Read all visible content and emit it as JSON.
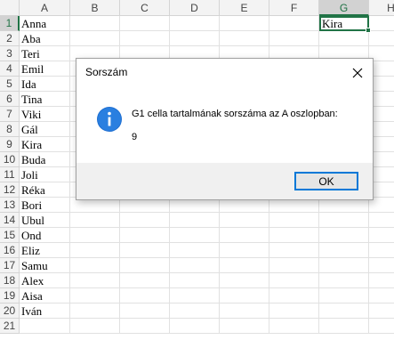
{
  "sheet": {
    "columns": [
      "A",
      "B",
      "C",
      "D",
      "E",
      "F",
      "G",
      "H"
    ],
    "column_a_values": [
      "Anna",
      "Aba",
      "Teri",
      "Emil",
      "Ida",
      "Tina",
      "Viki",
      "Gál",
      "Kira",
      "Buda",
      "Joli",
      "Réka",
      "Bori",
      "Ubul",
      "Ond",
      "Eliz",
      "Samu",
      "Alex",
      "Aisa",
      "Iván",
      ""
    ],
    "row_numbers": [
      "1",
      "2",
      "3",
      "4",
      "5",
      "6",
      "7",
      "8",
      "9",
      "10",
      "11",
      "12",
      "13",
      "14",
      "15",
      "16",
      "17",
      "18",
      "19",
      "20",
      "21"
    ],
    "active_cell_value": "Kira",
    "selection_color": "#217346"
  },
  "dialog": {
    "title": "Sorszám",
    "message_line1": "G1 cella tartalmának sorszáma az A oszlopban:",
    "message_line2": "9",
    "ok_label": "OK",
    "icon": "information-icon",
    "accent_color": "#0078d7"
  }
}
